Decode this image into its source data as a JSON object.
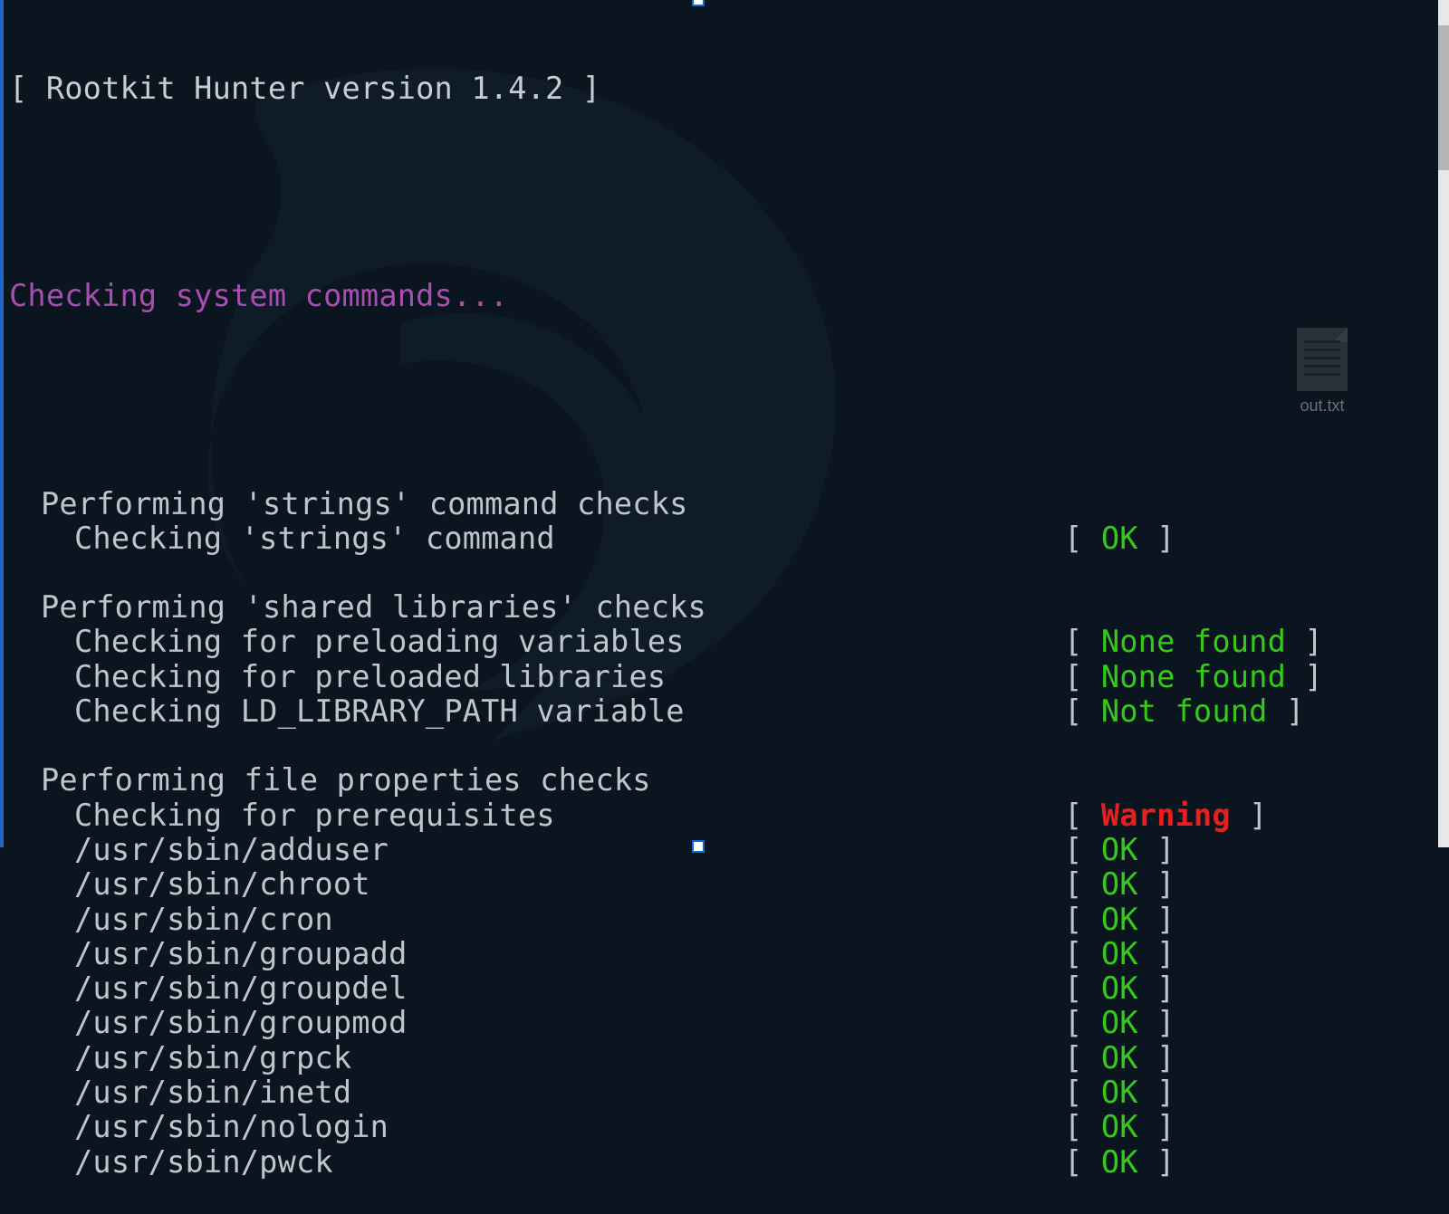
{
  "title": "[ Rootkit Hunter version 1.4.2 ]",
  "section_heading": "Checking system commands...",
  "desktop_file_label": "out.txt",
  "status_labels": {
    "ok": "OK",
    "none_found": "None found",
    "not_found": "Not found",
    "warning": "Warning"
  },
  "groups": [
    {
      "header": "Performing 'strings' command checks",
      "items": [
        {
          "text": "Checking 'strings' command",
          "status": "ok"
        }
      ]
    },
    {
      "header": "Performing 'shared libraries' checks",
      "items": [
        {
          "text": "Checking for preloading variables",
          "status": "none_found"
        },
        {
          "text": "Checking for preloaded libraries",
          "status": "none_found"
        },
        {
          "text": "Checking LD_LIBRARY_PATH variable",
          "status": "not_found"
        }
      ]
    },
    {
      "header": "Performing file properties checks",
      "items": [
        {
          "text": "Checking for prerequisites",
          "status": "warning"
        },
        {
          "text": "/usr/sbin/adduser",
          "status": "ok"
        },
        {
          "text": "/usr/sbin/chroot",
          "status": "ok"
        },
        {
          "text": "/usr/sbin/cron",
          "status": "ok"
        },
        {
          "text": "/usr/sbin/groupadd",
          "status": "ok"
        },
        {
          "text": "/usr/sbin/groupdel",
          "status": "ok"
        },
        {
          "text": "/usr/sbin/groupmod",
          "status": "ok"
        },
        {
          "text": "/usr/sbin/grpck",
          "status": "ok"
        },
        {
          "text": "/usr/sbin/inetd",
          "status": "ok"
        },
        {
          "text": "/usr/sbin/nologin",
          "status": "ok"
        },
        {
          "text": "/usr/sbin/pwck",
          "status": "ok"
        }
      ]
    }
  ],
  "colors": {
    "ok": "#35c91a",
    "warning": "#e61f1f",
    "heading": "#a94db0",
    "text": "#bfc5cc",
    "bg": "#0a1520"
  }
}
